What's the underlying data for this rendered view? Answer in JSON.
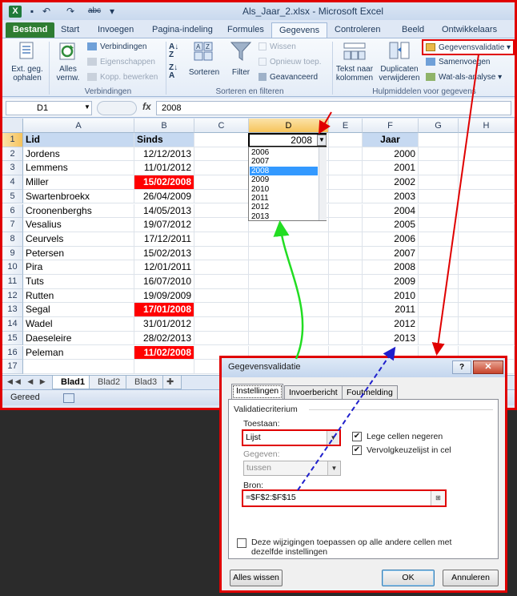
{
  "window": {
    "title": "Als_Jaar_2.xlsx - Microsoft Excel"
  },
  "quick_access": {
    "undo": "↶",
    "redo": "↷",
    "abc": "abc"
  },
  "tabs": [
    "Bestand",
    "Start",
    "Invoegen",
    "Pagina-indeling",
    "Formules",
    "Gegevens",
    "Controleren",
    "Beeld",
    "Ontwikkelaars"
  ],
  "ribbon": {
    "ext_data": "Ext. geg.\nophalen",
    "refresh_all": "Alles\nvernw.",
    "connections": "Verbindingen",
    "properties": "Eigenschappen",
    "edit_links": "Kopp. bewerken",
    "group_connections": "Verbindingen",
    "sort": "Sorteren",
    "filter": "Filter",
    "clear": "Wissen",
    "reapply": "Opnieuw toep.",
    "advanced": "Geavanceerd",
    "group_sortfilter": "Sorteren en filteren",
    "text_to_columns": "Tekst naar\nkolommen",
    "remove_duplicates": "Duplicaten\nverwijderen",
    "data_validation": "Gegevensvalidatie",
    "consolidate": "Samenvoegen",
    "what_if": "Wat-als-analyse",
    "group_tools": "Hulpmiddelen voor gegevens"
  },
  "formula_bar": {
    "name_box": "D1",
    "fx": "fx",
    "value": "2008"
  },
  "grid": {
    "columns": [
      "A",
      "B",
      "C",
      "D",
      "E",
      "F",
      "G",
      "H"
    ],
    "rows": [
      "1",
      "2",
      "3",
      "4",
      "5",
      "6",
      "7",
      "8",
      "9",
      "10",
      "11",
      "12",
      "13",
      "14",
      "15",
      "16",
      "17"
    ],
    "header_a": "Lid",
    "header_b": "Sinds",
    "header_f": "Jaar",
    "d1_value": "2008",
    "names": [
      "Jordens",
      "Lemmens",
      "Miller",
      "Swartenbroekx",
      "Croonenberghs",
      "Vesalius",
      "Ceurvels",
      "Petersen",
      "Pira",
      "Tuts",
      "Rutten",
      "Segal",
      "Wadel",
      "Daeseleire",
      "Peleman"
    ],
    "dates": [
      "12/12/2013",
      "11/01/2012",
      "15/02/2008",
      "26/04/2009",
      "14/05/2013",
      "19/07/2012",
      "17/12/2011",
      "15/02/2013",
      "12/01/2011",
      "16/07/2010",
      "19/09/2009",
      "17/01/2008",
      "31/01/2012",
      "28/02/2013",
      "11/02/2008"
    ],
    "highlighted_rows": [
      2,
      11,
      14
    ],
    "years": [
      "2000",
      "2001",
      "2002",
      "2003",
      "2004",
      "2005",
      "2006",
      "2007",
      "2008",
      "2009",
      "2010",
      "2011",
      "2012",
      "2013"
    ]
  },
  "dropdown": {
    "items": [
      "2006",
      "2007",
      "2008",
      "2009",
      "2010",
      "2011",
      "2012",
      "2013"
    ],
    "selected": "2008"
  },
  "sheet_tabs": [
    "Blad1",
    "Blad2",
    "Blad3"
  ],
  "status": {
    "text": "Gereed"
  },
  "dialog": {
    "title": "Gegevensvalidatie",
    "help": "?",
    "close": "✕",
    "tabs": [
      "Instellingen",
      "Invoerbericht",
      "Foutmelding"
    ],
    "criteria_label": "Validatiecriterium",
    "allow_label": "Toestaan:",
    "allow_value": "Lijst",
    "ignore_blank": "Lege cellen negeren",
    "in_cell_dropdown": "Vervolgkeuzelijst in cel",
    "data_label": "Gegeven:",
    "data_value": "tussen",
    "source_label": "Bron:",
    "source_value": "=$F$2:$F$15",
    "apply_all": "Deze wijzigingen toepassen op alle andere cellen met dezelfde instellingen",
    "clear_all": "Alles wissen",
    "ok": "OK",
    "cancel": "Annuleren"
  },
  "colors": {
    "highlight": "#e00000",
    "green_arrow": "#22dd22",
    "blue_arrow": "#1f1fcc",
    "header_fill": "#c6d9f1"
  }
}
